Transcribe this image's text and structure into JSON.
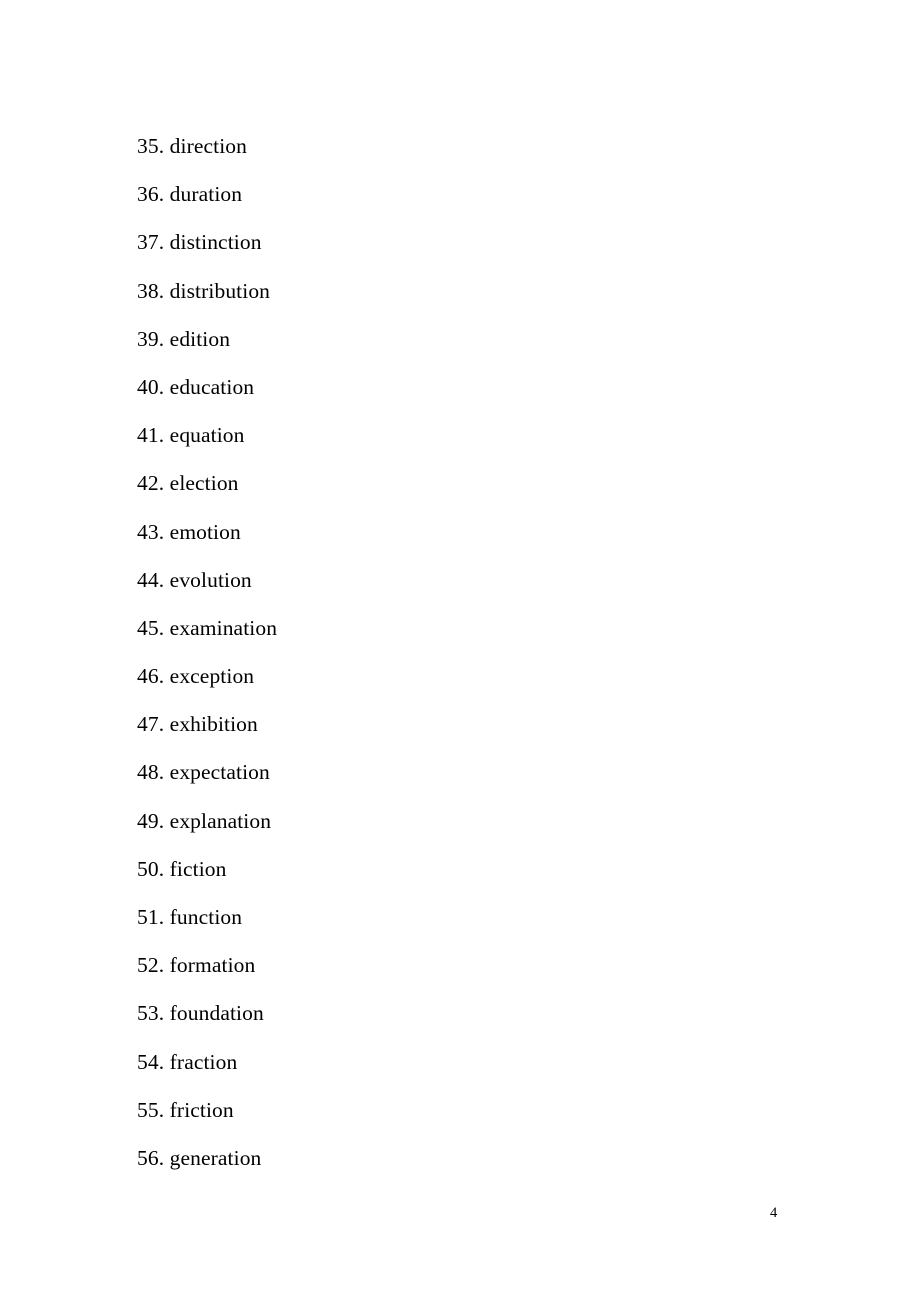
{
  "document": {
    "page_number": "4",
    "list": {
      "items": [
        {
          "number": "35.",
          "word": "direction"
        },
        {
          "number": "36.",
          "word": "duration"
        },
        {
          "number": "37.",
          "word": "distinction"
        },
        {
          "number": "38.",
          "word": "distribution"
        },
        {
          "number": "39.",
          "word": "edition"
        },
        {
          "number": "40.",
          "word": "education"
        },
        {
          "number": "41.",
          "word": "equation"
        },
        {
          "number": "42.",
          "word": "election"
        },
        {
          "number": "43.",
          "word": "emotion"
        },
        {
          "number": "44.",
          "word": "evolution"
        },
        {
          "number": "45.",
          "word": "examination"
        },
        {
          "number": "46.",
          "word": "exception"
        },
        {
          "number": "47.",
          "word": "exhibition"
        },
        {
          "number": "48.",
          "word": "expectation"
        },
        {
          "number": "49.",
          "word": "explanation"
        },
        {
          "number": "50.",
          "word": "fiction"
        },
        {
          "number": "51.",
          "word": "function"
        },
        {
          "number": "52.",
          "word": "formation"
        },
        {
          "number": "53.",
          "word": "foundation"
        },
        {
          "number": "54.",
          "word": "fraction"
        },
        {
          "number": "55.",
          "word": "friction"
        },
        {
          "number": "56.",
          "word": "generation"
        }
      ]
    }
  }
}
